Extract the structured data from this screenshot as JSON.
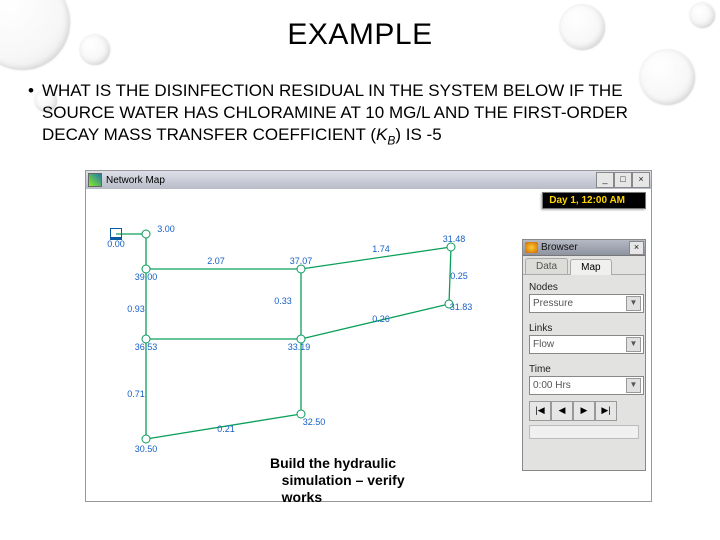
{
  "title": "EXAMPLE",
  "bullet": {
    "pre": "WHAT IS THE DISINFECTION RESIDUAL IN THE SYSTEM BELOW IF THE SOURCE WATER HAS CHLORAMINE AT 10 MG/L AND THE FIRST-ORDER DECAY MASS TRANSFER COEFFICIENT (",
    "kvar": "K",
    "ksub": "B",
    "post": ") IS -5"
  },
  "window": {
    "title": "Network Map",
    "buttons": {
      "min": "_",
      "max": "□",
      "close": "×"
    }
  },
  "status": "Day 1, 12:00 AM",
  "browser": {
    "title": "Browser",
    "close": "×",
    "tabs": {
      "data": "Data",
      "map": "Map"
    },
    "groups": {
      "nodes": {
        "label": "Nodes",
        "value": "Pressure"
      },
      "links": {
        "label": "Links",
        "value": "Flow"
      },
      "time": {
        "label": "Time",
        "value": "0:00 Hrs"
      }
    },
    "arrow": "▼",
    "vcr": {
      "first": "|◀",
      "prev": "◀",
      "next": "▶",
      "last": "▶|"
    }
  },
  "caption": {
    "l1": "Build the hydraulic",
    "l2": "simulation – verify",
    "l3": "works"
  },
  "labels": {
    "r": "0.00",
    "t1": "3.00",
    "t2": "2.07",
    "t3": "37.07",
    "t4": "1.74",
    "t5": "31.48",
    "m1": "39.00",
    "m2": "33.19",
    "m3": "0.33",
    "m4": "0.25",
    "l1": "0.93",
    "r83": "31.83",
    "n3653": "36.53",
    "m5": "0.26",
    "b1": "0.71",
    "b2": "32.50",
    "bl": "30.50",
    "br": "0.21"
  }
}
